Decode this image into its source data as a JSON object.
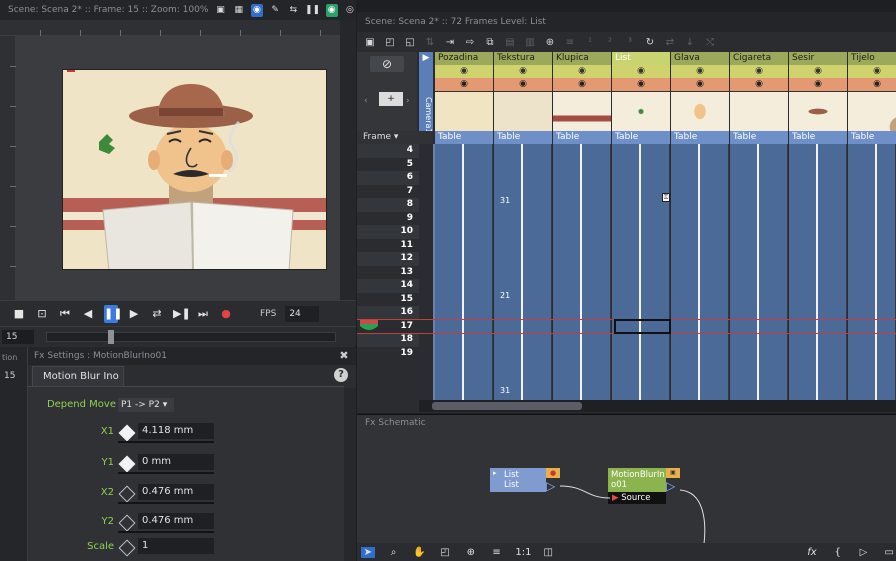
{
  "viewer": {
    "title": "Scene: Scena 2*  ::  Frame: 15  ::  Zoom: 100%",
    "fps_label": "FPS",
    "fps_value": "24",
    "frame_value": "15"
  },
  "fx_settings": {
    "title": "Fx Settings : MotionBlurIno01",
    "tab": "Motion Blur Ino",
    "side_labels": [
      "tion",
      "15"
    ],
    "depend_move_label": "Depend Move",
    "depend_move_value": "P1 -> P2",
    "params": [
      {
        "label": "X1",
        "value": "4.118 mm"
      },
      {
        "label": "Y1",
        "value": "0 mm"
      },
      {
        "label": "X2",
        "value": "0.476 mm"
      },
      {
        "label": "Y2",
        "value": "0.476 mm"
      },
      {
        "label": "Scale",
        "value": "1"
      }
    ]
  },
  "xsheet": {
    "title": "Scene: Scena 2*  ::  72 Frames  Level: List",
    "camera_label": "Camera1",
    "frame_header": "Frame",
    "columns": [
      {
        "name": "Pozadina",
        "type": "Table"
      },
      {
        "name": "Tekstura",
        "type": "Table"
      },
      {
        "name": "Klupica",
        "type": "Table"
      },
      {
        "name": "List",
        "type": "Table"
      },
      {
        "name": "Glava",
        "type": "Table"
      },
      {
        "name": "Cigareta",
        "type": "Table"
      },
      {
        "name": "Sesir",
        "type": "Table"
      },
      {
        "name": "Tijelo",
        "type": "Table"
      }
    ],
    "rows": [
      "4",
      "5",
      "6",
      "7",
      "8",
      "9",
      "10",
      "11",
      "12",
      "13",
      "14",
      "15",
      "16",
      "17",
      "18",
      "19"
    ],
    "cell_labels": [
      {
        "row": "7",
        "col": "Tekstura",
        "text": "31"
      },
      {
        "row": "13",
        "col": "Tekstura",
        "text": "21"
      },
      {
        "row": "19",
        "col": "Tekstura",
        "text": "31"
      }
    ],
    "current_frame": "15"
  },
  "schematic": {
    "title": "Fx Schematic",
    "node_list": {
      "line1": "List",
      "line2": "List"
    },
    "node_blur": {
      "line1": "MotionBlurIn",
      "line2": "o01",
      "port": "Source"
    },
    "zoom_label": "1:1"
  },
  "colors": {
    "accent_blue": "#3e7be0",
    "param_label_green": "#8fd14f",
    "cell_blue": "#4c6a98",
    "column_header_olive": "#9ca85a"
  }
}
